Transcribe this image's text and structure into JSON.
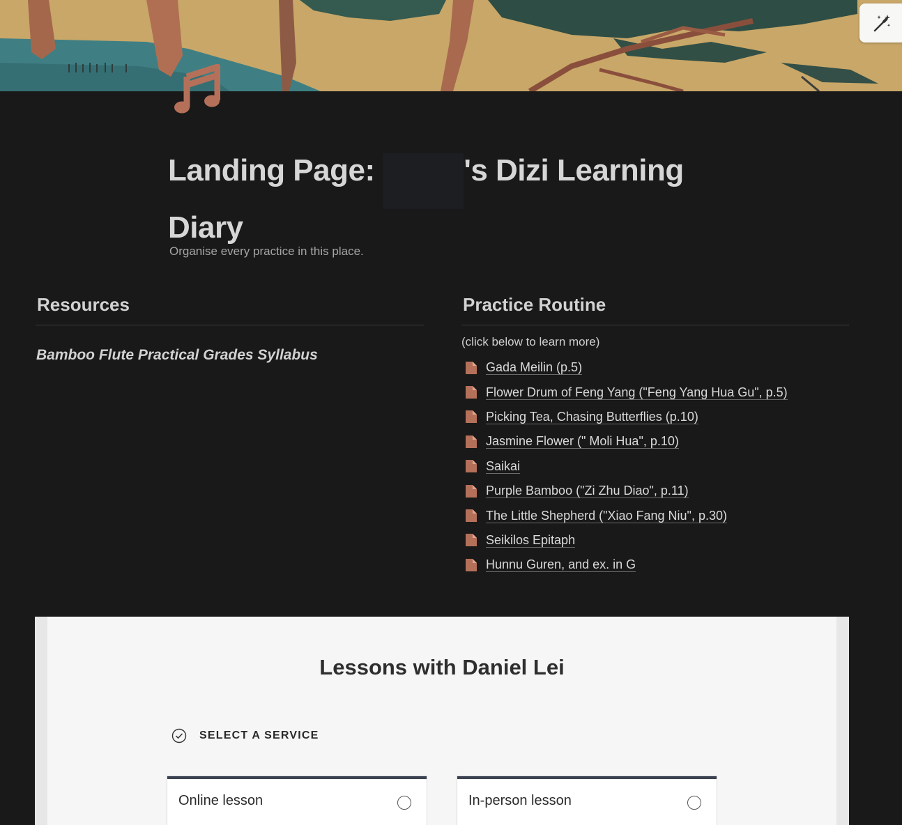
{
  "page": {
    "icon": "music-note-icon",
    "title_prefix": "Landing Page: ",
    "title_suffix": "'s Dizi Learning Diary",
    "subtitle": "Organise every practice in this place."
  },
  "toolbar": {
    "ai_icon": "magic-wand-icon"
  },
  "resources": {
    "heading": "Resources",
    "links": [
      "Bamboo Flute Practical Grades Syllabus"
    ]
  },
  "practice": {
    "heading": "Practice Routine",
    "hint": "(click below to learn more)",
    "items": [
      "Gada Meilin (p.5)",
      "Flower Drum of Feng Yang (\"Feng Yang Hua Gu\", p.5)",
      "Picking Tea, Chasing Butterflies (p.10)",
      "Jasmine Flower (\" Moli Hua\", p.10)",
      "Saikai",
      "Purple Bamboo (\"Zi Zhu Diao\", p.11)",
      "The Little Shepherd (\"Xiao Fang Niu\", p.30)",
      "Seikilos Epitaph",
      "Hunnu Guren, and ex. in G"
    ]
  },
  "booking": {
    "title": "Lessons with Daniel Lei",
    "step_label": "SELECT A SERVICE",
    "services": [
      "Online lesson",
      "In-person lesson"
    ]
  },
  "colors": {
    "background": "#191919",
    "accent_icon": "#b5705a",
    "card_top_border": "#3b4251"
  }
}
